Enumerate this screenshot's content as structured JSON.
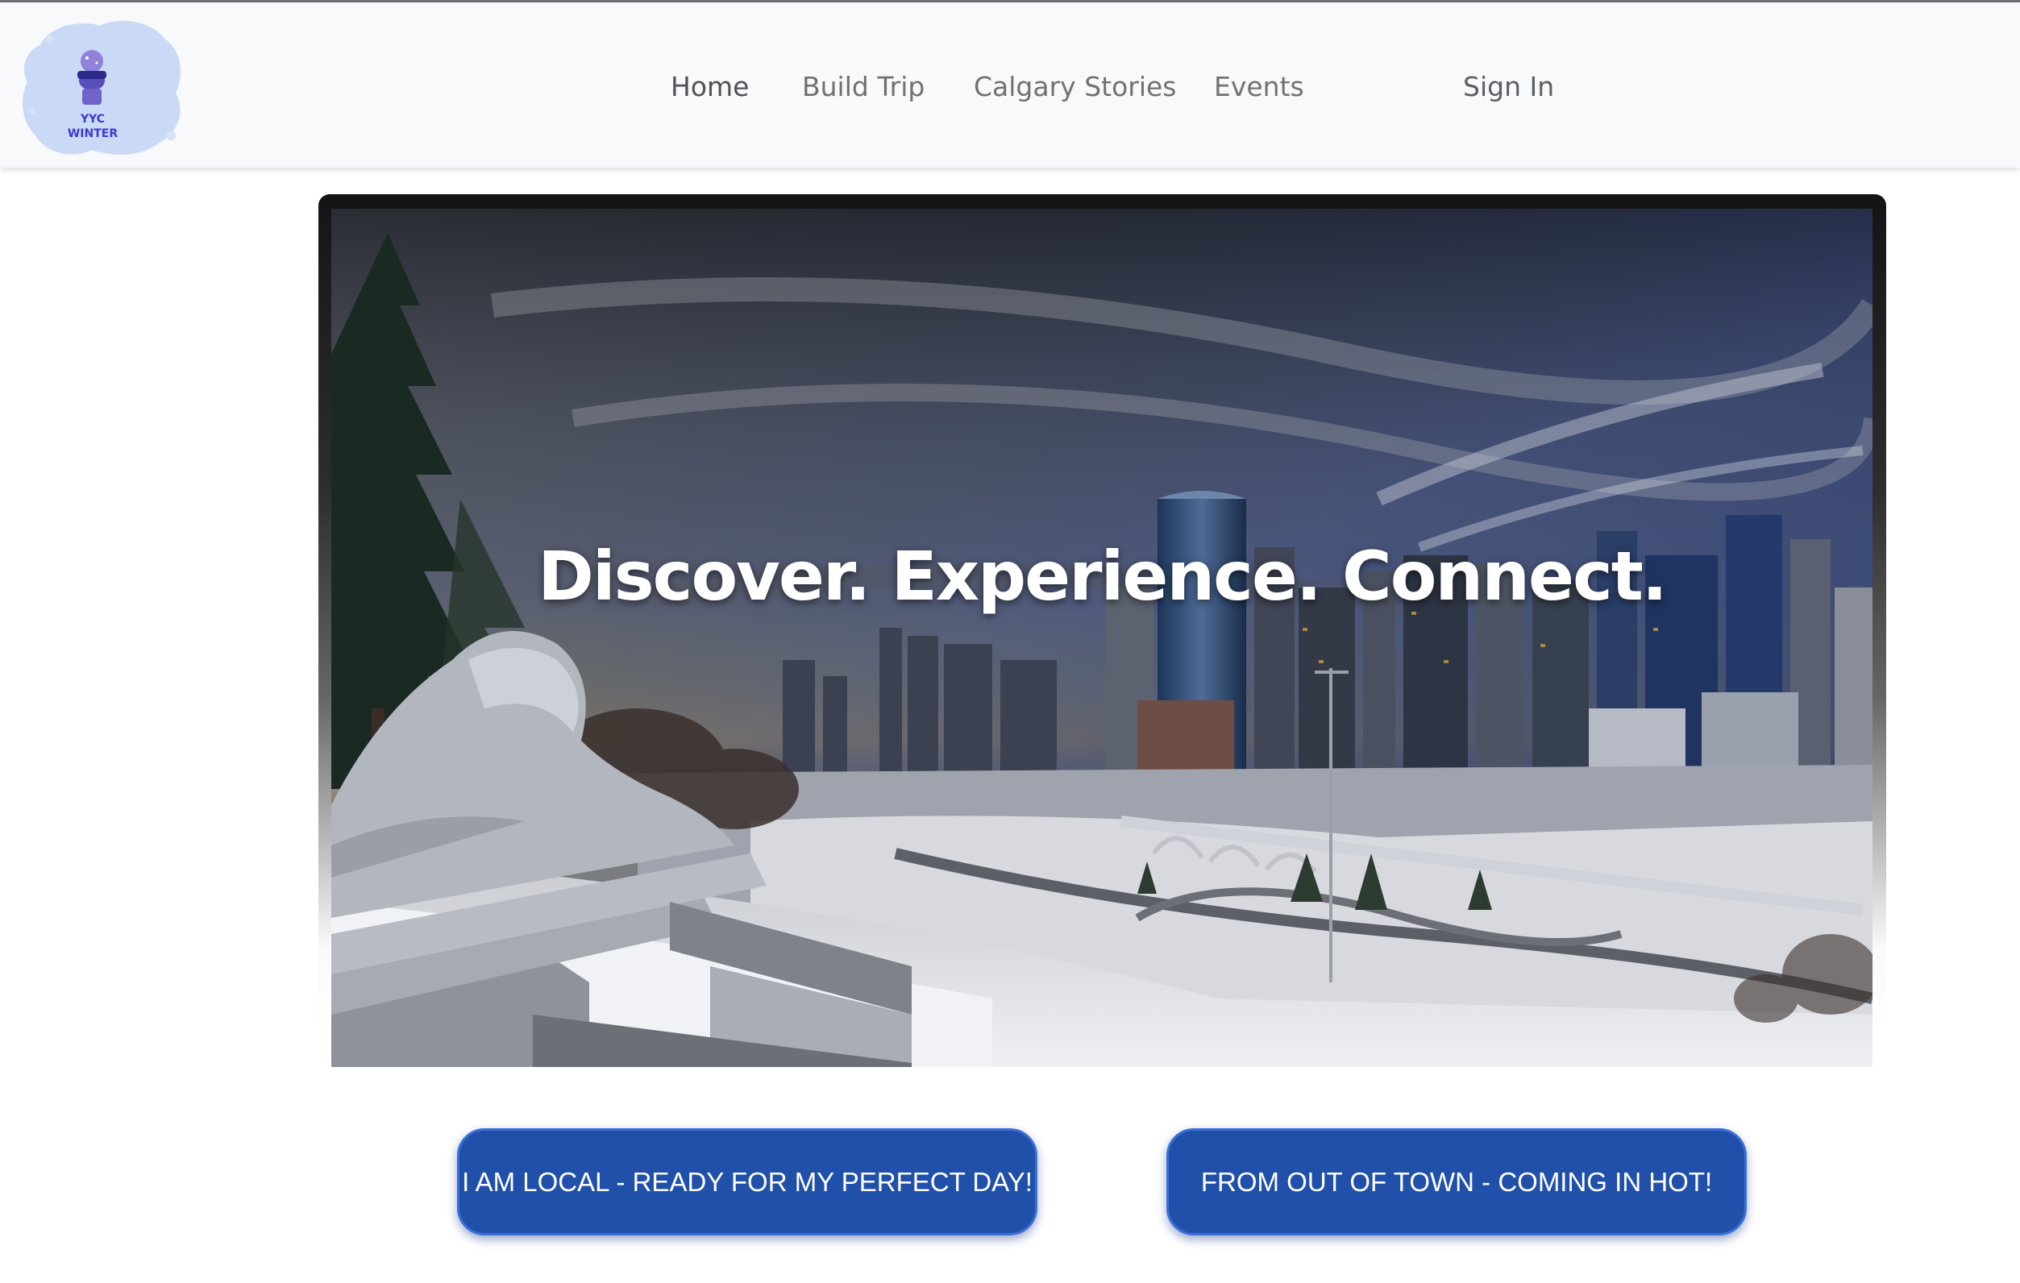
{
  "logo": {
    "line1": "YYC",
    "line2": "WINTER",
    "colors": {
      "splash": "#c9d9f6",
      "text": "#3b3ad0",
      "figure": "#7b6bd0"
    }
  },
  "nav": {
    "items": [
      {
        "label": "Home",
        "active": true
      },
      {
        "label": "Build Trip",
        "active": false
      },
      {
        "label": "Calgary Stories",
        "active": false
      },
      {
        "label": "Events",
        "active": false
      }
    ],
    "sign_in": "Sign In"
  },
  "hero": {
    "title": "Discover. Experience. Connect."
  },
  "cta": {
    "local": "I AM LOCAL - READY FOR MY PERFECT DAY!",
    "out_of_town": "FROM OUT OF TOWN - COMING IN HOT!"
  },
  "colors": {
    "button": "#2050aa",
    "navbar": "#f8f9fa",
    "nav_text": "#6f7275"
  }
}
